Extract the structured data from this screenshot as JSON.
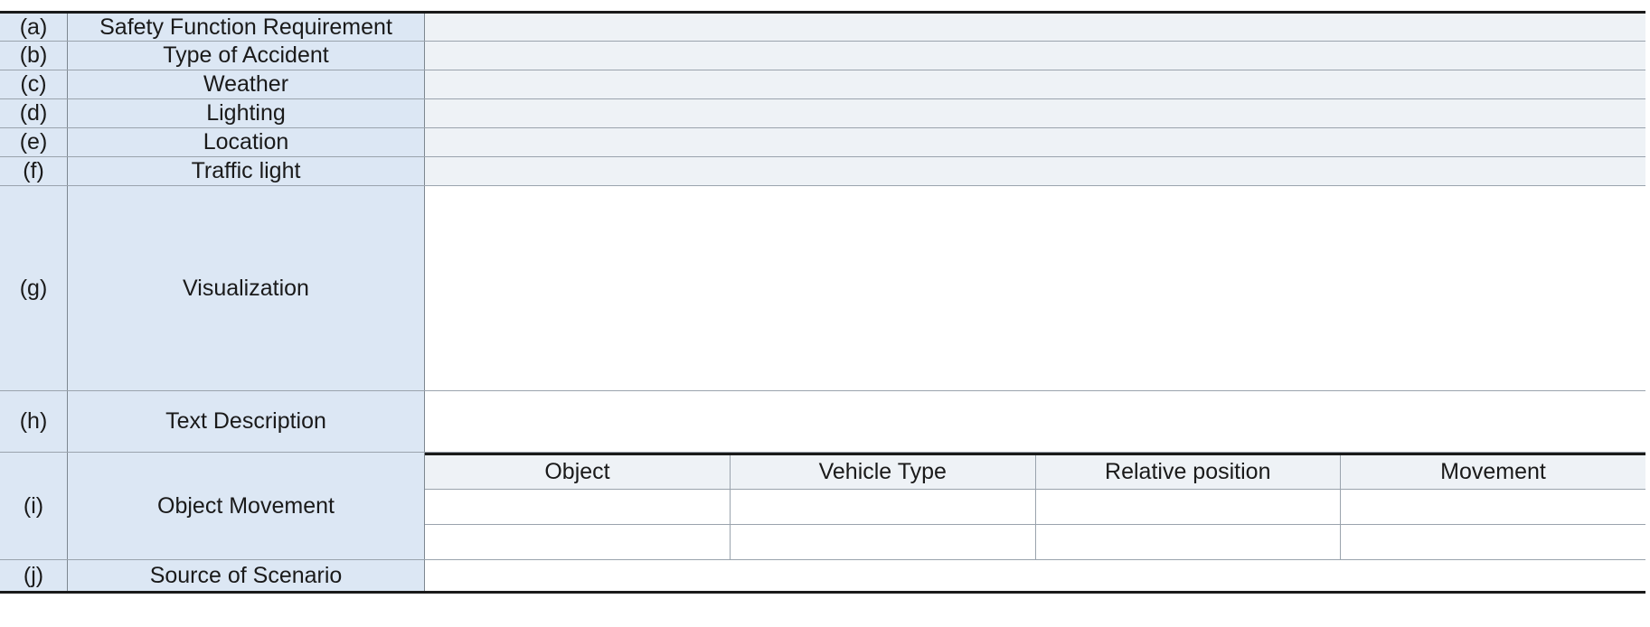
{
  "rows": [
    {
      "code": "(a)",
      "label": "Safety Function Requirement"
    },
    {
      "code": "(b)",
      "label": "Type of Accident"
    },
    {
      "code": "(c)",
      "label": "Weather"
    },
    {
      "code": "(d)",
      "label": "Lighting"
    },
    {
      "code": "(e)",
      "label": "Location"
    },
    {
      "code": "(f)",
      "label": "Traffic light"
    },
    {
      "code": "(g)",
      "label": "Visualization"
    },
    {
      "code": "(h)",
      "label": "Text Description"
    },
    {
      "code": "(i)",
      "label": "Object Movement"
    },
    {
      "code": "(j)",
      "label": "Source of Scenario"
    }
  ],
  "object_movement": {
    "columns": [
      "Object",
      "Vehicle Type",
      "Relative position",
      "Movement"
    ],
    "rows": [
      [
        "",
        "",
        "",
        ""
      ],
      [
        "",
        "",
        "",
        ""
      ]
    ]
  },
  "colors": {
    "label_fill": "#dce7f4",
    "value_fill": "#eef2f6",
    "rule_heavy": "#1a1a1a",
    "rule_light": "#9aa3ad"
  }
}
